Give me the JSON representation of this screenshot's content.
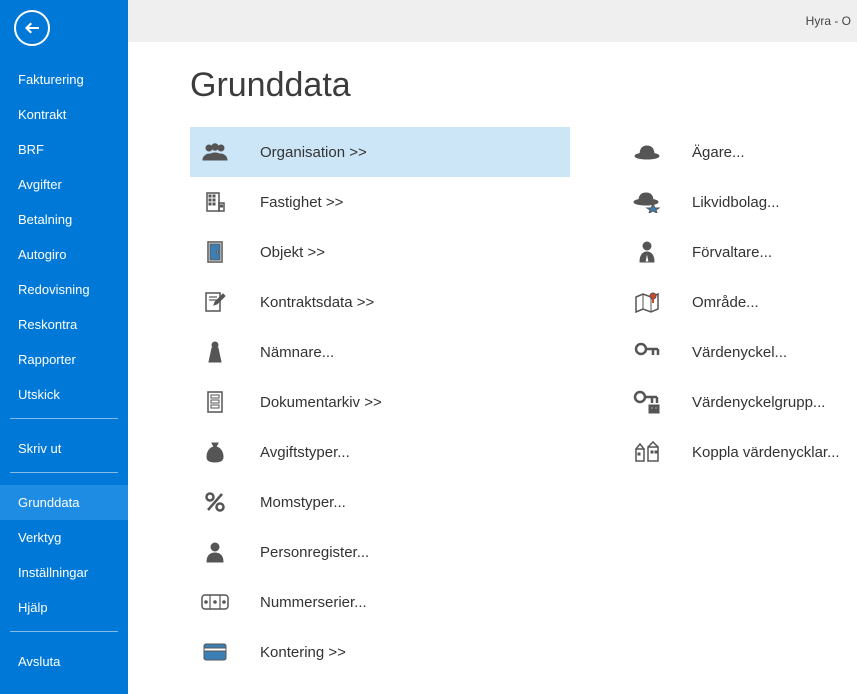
{
  "topbar": {
    "title": "Hyra - O"
  },
  "sidebar": {
    "group1": [
      {
        "label": "Fakturering"
      },
      {
        "label": "Kontrakt"
      },
      {
        "label": "BRF"
      },
      {
        "label": "Avgifter"
      },
      {
        "label": "Betalning"
      },
      {
        "label": "Autogiro"
      },
      {
        "label": "Redovisning"
      },
      {
        "label": "Reskontra"
      },
      {
        "label": "Rapporter"
      },
      {
        "label": "Utskick"
      }
    ],
    "group2": [
      {
        "label": "Skriv ut"
      }
    ],
    "group3": [
      {
        "label": "Grunddata",
        "active": true
      },
      {
        "label": "Verktyg"
      },
      {
        "label": "Inställningar"
      },
      {
        "label": "Hjälp"
      }
    ],
    "group4": [
      {
        "label": "Avsluta"
      }
    ]
  },
  "page": {
    "heading": "Grunddata",
    "leftItems": [
      {
        "icon": "group-icon",
        "label": "Organisation >>",
        "selected": true
      },
      {
        "icon": "building-icon",
        "label": "Fastighet >>"
      },
      {
        "icon": "door-icon",
        "label": "Objekt >>"
      },
      {
        "icon": "contract-icon",
        "label": "Kontraktsdata >>"
      },
      {
        "icon": "weight-icon",
        "label": "Nämnare..."
      },
      {
        "icon": "archive-icon",
        "label": "Dokumentarkiv >>"
      },
      {
        "icon": "moneybag-icon",
        "label": "Avgiftstyper..."
      },
      {
        "icon": "percent-icon",
        "label": "Momstyper..."
      },
      {
        "icon": "person-icon",
        "label": "Personregister..."
      },
      {
        "icon": "counter-icon",
        "label": "Nummerserier..."
      },
      {
        "icon": "card-icon",
        "label": "Kontering >>"
      }
    ],
    "rightItems": [
      {
        "icon": "hat-icon",
        "label": "Ägare..."
      },
      {
        "icon": "hat-star-icon",
        "label": "Likvidbolag..."
      },
      {
        "icon": "manager-icon",
        "label": "Förvaltare..."
      },
      {
        "icon": "map-icon",
        "label": "Område..."
      },
      {
        "icon": "key-icon",
        "label": "Värdenyckel..."
      },
      {
        "icon": "key-group-icon",
        "label": "Värdenyckelgrupp..."
      },
      {
        "icon": "key-property-icon",
        "label": "Koppla värdenycklar..."
      }
    ]
  }
}
